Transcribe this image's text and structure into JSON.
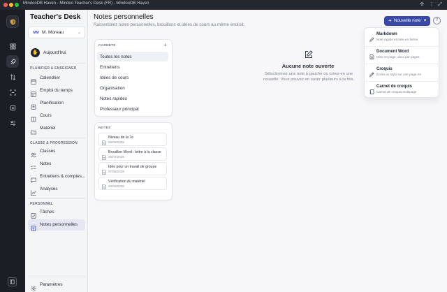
{
  "window": {
    "title": "MindooDB Haven - Mindoo Teacher's Desk (FR) - MindooDB Haven"
  },
  "brand": {
    "prefix": "Teacher's",
    "suffix": "Desk"
  },
  "user": {
    "initials": "MM",
    "name": "M. Moreau"
  },
  "today": {
    "label": "Aujourd'hui"
  },
  "sections": {
    "plan": "PLANIFIER & ENSEIGNER",
    "classes": "CLASSE & PROGRESSION",
    "personal": "PERSONNEL"
  },
  "nav_plan": [
    "Calendrier",
    "Emploi du temps",
    "Planification",
    "Cours",
    "Matériel"
  ],
  "nav_classes": [
    "Classes",
    "Notes",
    "Entretiens & comptes...",
    "Analyses"
  ],
  "nav_personal": [
    "Tâches",
    "Notes personnelles"
  ],
  "settings": {
    "label": "Paramètres"
  },
  "header": {
    "title": "Notes personnelles",
    "subtitle": "Rassemblez notes personnelles, brouillons et idées de cours au même endroit."
  },
  "new_button": {
    "label": "Nouvelle note",
    "plus": "+",
    "chevron": "▾"
  },
  "help": {
    "label": "?"
  },
  "notebooks": {
    "heading": "CARNETS",
    "add": "+",
    "items": [
      "Toutes les notes",
      "Entretiens",
      "Idées de cours",
      "Organisation",
      "Notes rapides",
      "Professeur principal"
    ]
  },
  "notes": {
    "heading": "NOTES",
    "items": [
      {
        "title": "Niveau de la 7e",
        "date": "05/09/2025"
      },
      {
        "title": "Brouillon Word : lettre à la classe",
        "date": "26/07/2026"
      },
      {
        "title": "Idée pour un travail de groupe",
        "date": "07/08/2026"
      },
      {
        "title": "Vérification du matériel",
        "date": "03/09/2026"
      }
    ]
  },
  "empty": {
    "title": "Aucune note ouverte",
    "subtitle": "Sélectionnez une note à gauche ou créez-en une nouvelle. Vous pouvez en ouvrir plusieurs à la fois."
  },
  "dropdown": [
    {
      "title": "Markdown",
      "desc": "Note rapide et mise en forme",
      "icon": "pen-icon"
    },
    {
      "title": "Document Word",
      "desc": "Mise en page, docx par pages",
      "icon": "document-icon"
    },
    {
      "title": "Croquis",
      "desc": "Écrire au stylo sur une page A4",
      "icon": "pencil-icon"
    },
    {
      "title": "Carnet de croquis",
      "desc": "Carnet de croquis multipage",
      "icon": "notebook-icon"
    }
  ],
  "colors": {
    "accent": "#3a48a8",
    "rail": "#1c1e25",
    "sidebar": "#f4f5f7"
  }
}
